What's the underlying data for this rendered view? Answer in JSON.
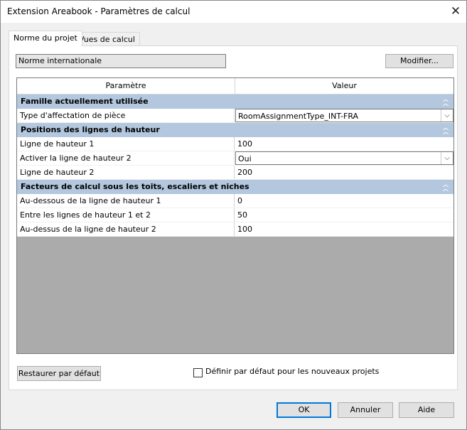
{
  "window": {
    "title": "Extension Areabook - Paramètres de calcul",
    "close_glyph": "✕"
  },
  "tabs": [
    {
      "label": "Norme du projet",
      "active": true
    },
    {
      "label": "Vues de calcul",
      "active": false
    }
  ],
  "norm": {
    "value": "Norme internationale",
    "modify_label": "Modifier..."
  },
  "grid": {
    "header": {
      "param": "Paramètre",
      "value": "Valeur"
    },
    "groups": [
      {
        "title": "Famille actuellement utilisée",
        "rows": [
          {
            "label": "Type d'affectation de pièce",
            "value": "RoomAssignmentType_INT-FRA",
            "type": "combo"
          }
        ]
      },
      {
        "title": "Positions des lignes de hauteur",
        "rows": [
          {
            "label": "Ligne de hauteur 1",
            "value": "100",
            "type": "text"
          },
          {
            "label": "Activer la ligne de hauteur 2",
            "value": "Oui",
            "type": "combo"
          },
          {
            "label": "Ligne de hauteur 2",
            "value": "200",
            "type": "text"
          }
        ]
      },
      {
        "title": "Facteurs de calcul sous les toits, escaliers et niches",
        "rows": [
          {
            "label": "Au-dessous de la ligne de hauteur 1",
            "value": "0",
            "type": "text"
          },
          {
            "label": "Entre les lignes de hauteur 1 et 2",
            "value": "50",
            "type": "text"
          },
          {
            "label": "Au-dessus de la ligne de hauteur 2",
            "value": "100",
            "type": "text"
          }
        ]
      }
    ]
  },
  "bottom": {
    "restore_label": "Restaurer par défaut",
    "default_checkbox_label": "Définir par défaut pour les nouveaux projets",
    "default_checked": false
  },
  "footer": {
    "ok": "OK",
    "cancel": "Annuler",
    "help": "Aide"
  },
  "icons": {
    "collapse": "chevrons-up-icon",
    "dropdown": "chevron-down-icon",
    "close": "close-icon"
  },
  "colors": {
    "group_header_bg": "#b3c7de",
    "grid_empty_bg": "#ababab",
    "primary_button_border": "#0078d7"
  }
}
